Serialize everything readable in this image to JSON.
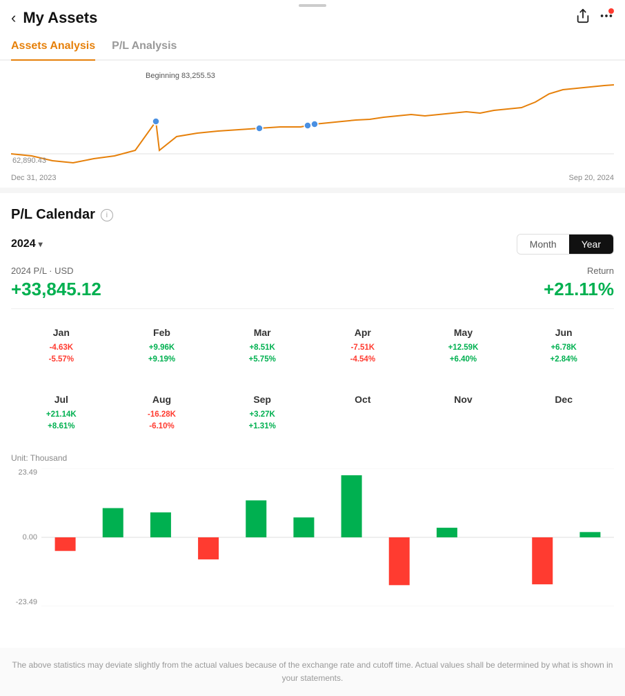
{
  "app": {
    "drag_handle": true,
    "back_label": "‹",
    "title": "My Assets",
    "share_icon": "share",
    "more_icon": "more"
  },
  "tabs": [
    {
      "id": "assets",
      "label": "Assets Analysis",
      "active": true
    },
    {
      "id": "pl",
      "label": "P/L Analysis",
      "active": false
    }
  ],
  "chart": {
    "begin_label": "Beginning 83,255.53",
    "y_label": "62,890.43",
    "date_start": "Dec 31, 2023",
    "date_end": "Sep 20, 2024"
  },
  "pl_calendar": {
    "section_title": "P/L Calendar",
    "info_icon": "i",
    "year": "2024",
    "toggle": {
      "month_label": "Month",
      "year_label": "Year",
      "active": "Year"
    },
    "summary": {
      "label": "2024 P/L · USD",
      "value": "+33,845.12",
      "return_label": "Return",
      "return_value": "+21.11%"
    },
    "months_row1": [
      {
        "name": "Jan",
        "pl": "-4.63K",
        "pct": "-5.57%",
        "positive": false
      },
      {
        "name": "Feb",
        "pl": "+9.96K",
        "pct": "+9.19%",
        "positive": true
      },
      {
        "name": "Mar",
        "pl": "+8.51K",
        "pct": "+5.75%",
        "positive": true
      },
      {
        "name": "Apr",
        "pl": "-7.51K",
        "pct": "-4.54%",
        "positive": false
      },
      {
        "name": "May",
        "pl": "+12.59K",
        "pct": "+6.40%",
        "positive": true
      },
      {
        "name": "Jun",
        "pl": "+6.78K",
        "pct": "+2.84%",
        "positive": true
      }
    ],
    "months_row2": [
      {
        "name": "Jul",
        "pl": "+21.14K",
        "pct": "+8.61%",
        "positive": true
      },
      {
        "name": "Aug",
        "pl": "-16.28K",
        "pct": "-6.10%",
        "positive": false
      },
      {
        "name": "Sep",
        "pl": "+3.27K",
        "pct": "+1.31%",
        "positive": true
      },
      {
        "name": "Oct",
        "pl": "",
        "pct": "",
        "positive": null
      },
      {
        "name": "Nov",
        "pl": "",
        "pct": "",
        "positive": null
      },
      {
        "name": "Dec",
        "pl": "",
        "pct": "",
        "positive": null
      }
    ],
    "bar_chart": {
      "unit_label": "Unit: Thousand",
      "y_max": "23.49",
      "y_zero": "0.00",
      "y_min": "-23.49",
      "bars": [
        {
          "month": "Jan",
          "value": -4.63,
          "positive": false
        },
        {
          "month": "Feb",
          "value": 9.96,
          "positive": true
        },
        {
          "month": "Mar",
          "value": 8.51,
          "positive": true
        },
        {
          "month": "Apr",
          "value": -7.51,
          "positive": false
        },
        {
          "month": "May",
          "value": 12.59,
          "positive": true
        },
        {
          "month": "Jun",
          "value": 6.78,
          "positive": true
        },
        {
          "month": "Jul",
          "value": 21.14,
          "positive": true
        },
        {
          "month": "Aug",
          "value": -16.28,
          "positive": false
        },
        {
          "month": "Sep",
          "value": 3.27,
          "positive": true
        },
        {
          "month": "Oct",
          "value": 0,
          "positive": null
        },
        {
          "month": "Nov",
          "value": -16,
          "positive": false
        },
        {
          "month": "Dec",
          "value": 1.8,
          "positive": true
        }
      ]
    },
    "disclaimer": "The above statistics may deviate slightly from the actual values because of the exchange rate and cutoff time. Actual values shall be determined by what is shown in your statements."
  }
}
